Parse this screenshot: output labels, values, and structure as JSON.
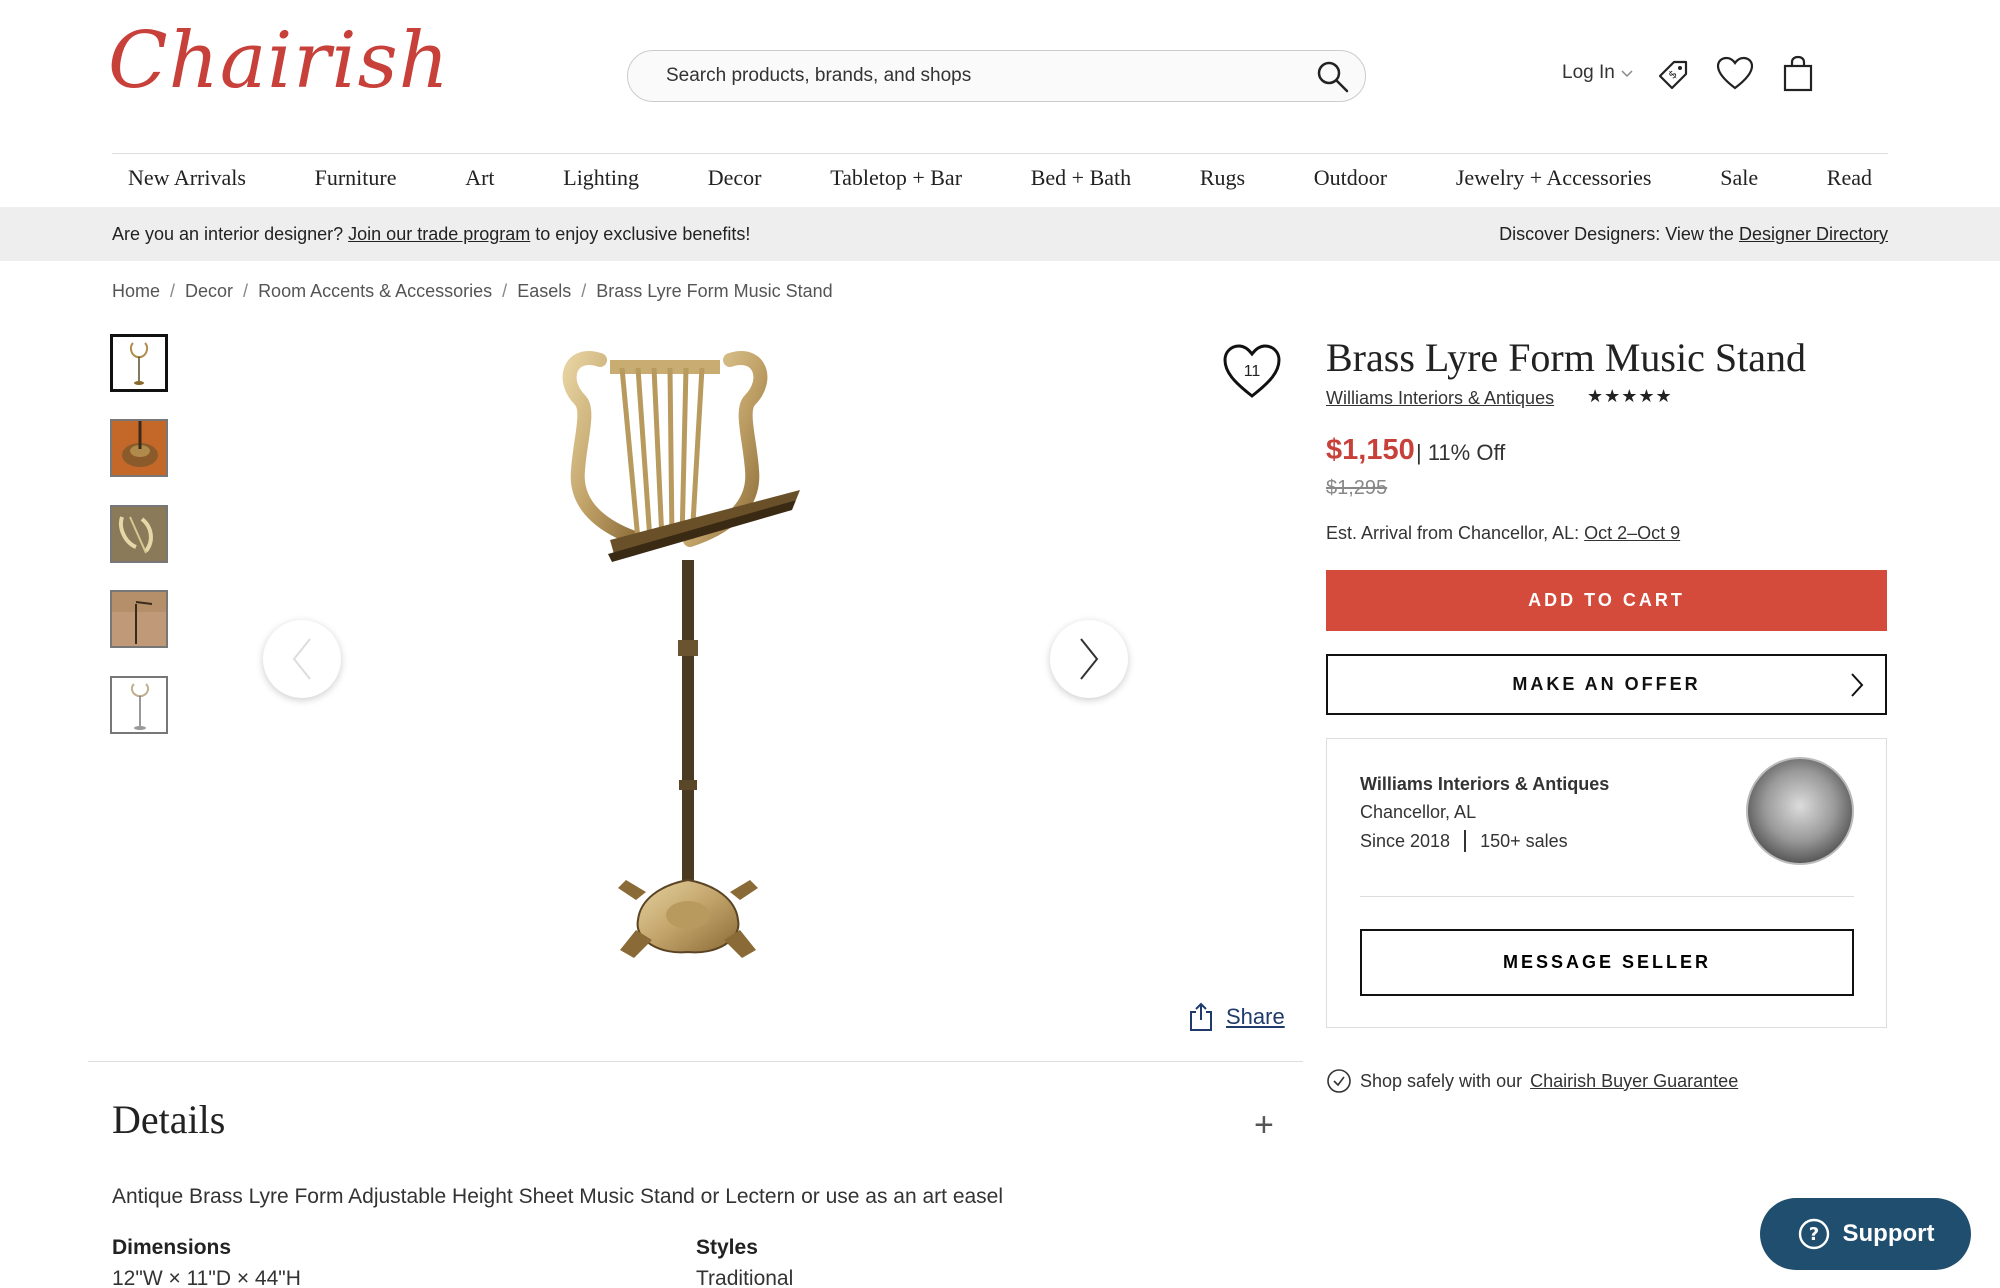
{
  "header": {
    "logo_text": "Chairish",
    "search_placeholder": "Search products, brands, and shops",
    "login_label": "Log In"
  },
  "nav": {
    "items": [
      "New Arrivals",
      "Furniture",
      "Art",
      "Lighting",
      "Decor",
      "Tabletop + Bar",
      "Bed + Bath",
      "Rugs",
      "Outdoor",
      "Jewelry + Accessories",
      "Sale",
      "Read"
    ]
  },
  "trade_banner": {
    "left_prefix": "Are you an interior designer?",
    "left_link": "Join our trade program",
    "left_suffix": "to enjoy exclusive benefits!",
    "right_prefix": "Discover Designers: View the",
    "right_link": "Designer Directory"
  },
  "breadcrumb": [
    "Home",
    "Decor",
    "Room Accents & Accessories",
    "Easels",
    "Brass Lyre Form Music Stand"
  ],
  "gallery": {
    "favorite_count": "11",
    "share_label": "Share"
  },
  "product": {
    "title": "Brass Lyre Form Music Stand",
    "seller_name": "Williams Interiors & Antiques",
    "rating_stars": "★★★★★",
    "price": "$1,150",
    "discount": "| 11% Off",
    "original_price": "$1,295",
    "arrival_prefix": "Est. Arrival from Chancellor, AL:",
    "arrival_dates": "Oct 2–Oct 9",
    "add_to_cart_label": "ADD TO CART",
    "make_offer_label": "MAKE AN OFFER"
  },
  "seller_box": {
    "name": "Williams Interiors & Antiques",
    "location": "Chancellor, AL",
    "since": "Since 2018",
    "sales": "150+ sales",
    "message_label": "MESSAGE SELLER"
  },
  "guarantee": {
    "prefix": "Shop safely with our",
    "link": "Chairish Buyer Guarantee"
  },
  "details": {
    "title": "Details",
    "description": "Antique Brass Lyre Form Adjustable Height Sheet Music Stand or Lectern or use as an art easel",
    "dimensions_label": "Dimensions",
    "dimensions_value": "12\"W × 11\"D × 44\"H",
    "styles_label": "Styles",
    "styles_value": "Traditional"
  },
  "support_label": "Support",
  "colors": {
    "brand_red": "#c8403a",
    "cart_button": "#d44a3b",
    "support_bg": "#1f4e6e"
  }
}
